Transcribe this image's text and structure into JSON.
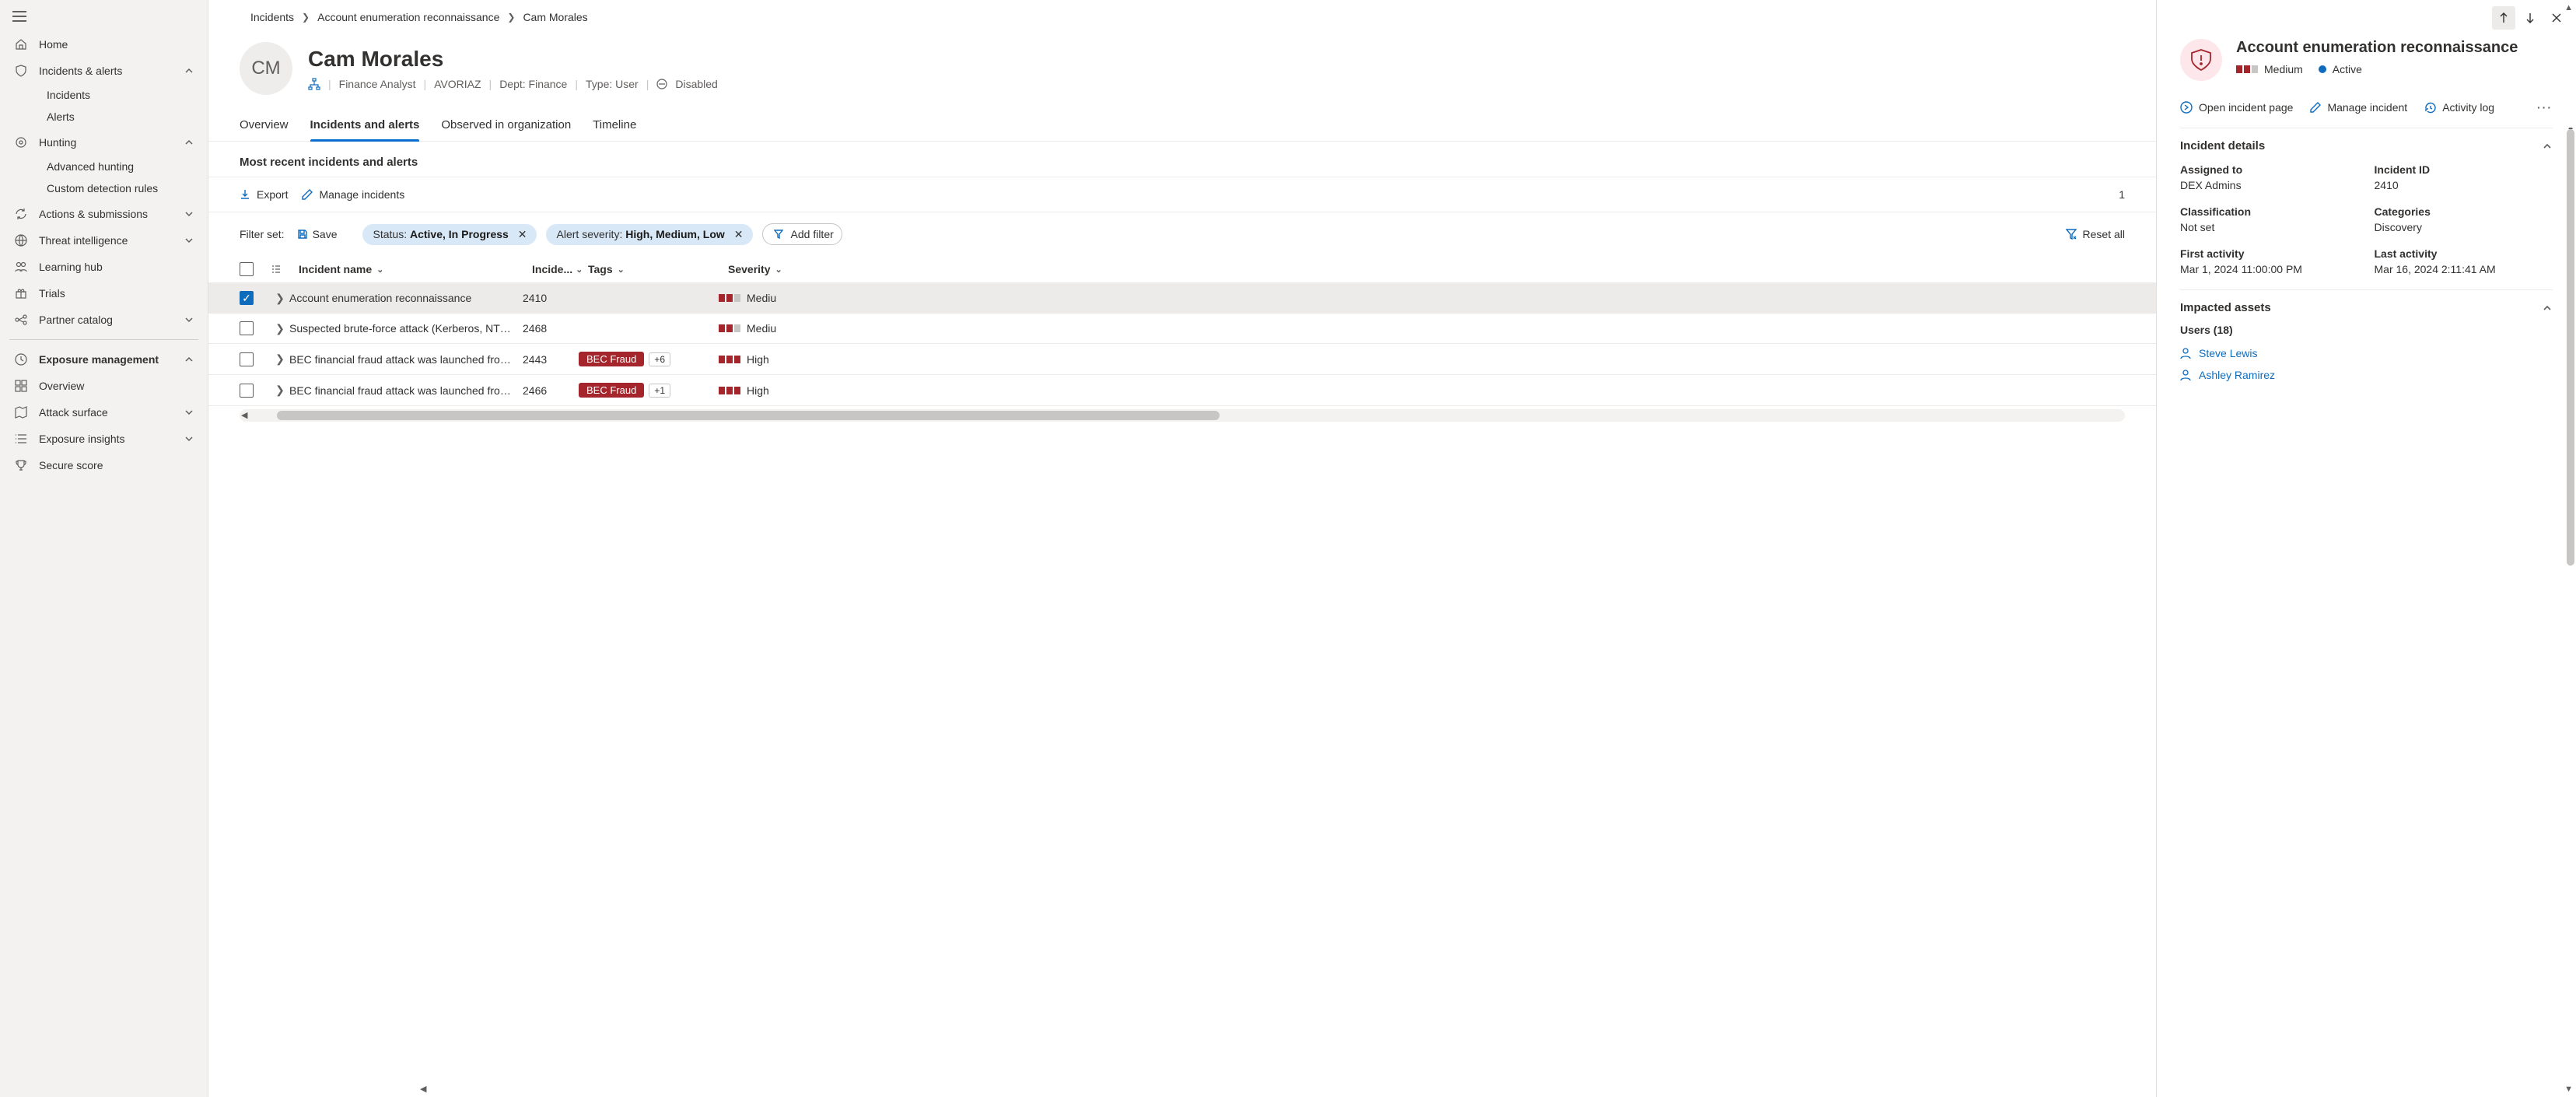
{
  "sidebar": {
    "home": "Home",
    "incidents_alerts": "Incidents & alerts",
    "incidents": "Incidents",
    "alerts": "Alerts",
    "hunting": "Hunting",
    "advanced_hunting": "Advanced hunting",
    "custom_rules": "Custom detection rules",
    "actions": "Actions & submissions",
    "threat_intel": "Threat intelligence",
    "learning": "Learning hub",
    "trials": "Trials",
    "partner": "Partner catalog",
    "exposure": "Exposure management",
    "overview": "Overview",
    "attack_surface": "Attack surface",
    "exposure_insights": "Exposure insights",
    "secure_score": "Secure score"
  },
  "breadcrumb": {
    "a": "Incidents",
    "b": "Account enumeration reconnaissance",
    "c": "Cam Morales"
  },
  "header": {
    "initials": "CM",
    "name": "Cam Morales",
    "role": "Finance Analyst",
    "host": "AVORIAZ",
    "dept": "Dept: Finance",
    "type": "Type: User",
    "disabled": "Disabled"
  },
  "tabs": {
    "overview": "Overview",
    "incidents": "Incidents and alerts",
    "observed": "Observed in organization",
    "timeline": "Timeline"
  },
  "section_title": "Most recent incidents and alerts",
  "toolbar": {
    "export": "Export",
    "manage": "Manage incidents",
    "count": "1"
  },
  "filters": {
    "label": "Filter set:",
    "save": "Save",
    "status_k": "Status: ",
    "status_v": "Active, In Progress",
    "sev_k": "Alert severity: ",
    "sev_v": "High, Medium, Low",
    "add": "Add filter",
    "reset": "Reset all"
  },
  "columns": {
    "name": "Incident name",
    "id": "Incide...",
    "tags": "Tags",
    "sev": "Severity"
  },
  "rows": [
    {
      "name": "Account enumeration reconnaissance",
      "id": "2410",
      "tags": [],
      "more": "",
      "sev": "Mediu",
      "sev_hi": 2,
      "checked": true
    },
    {
      "name": "Suspected brute-force attack (Kerberos, NTLM)",
      "id": "2468",
      "tags": [],
      "more": "",
      "sev": "Mediu",
      "sev_hi": 2,
      "checked": false
    },
    {
      "name": "BEC financial fraud attack was launched from a ...",
      "id": "2443",
      "tags": [
        "BEC Fraud"
      ],
      "more": "+6",
      "sev": "High",
      "sev_hi": 3,
      "checked": false
    },
    {
      "name": "BEC financial fraud attack was launched from a ...",
      "id": "2466",
      "tags": [
        "BEC Fraud"
      ],
      "more": "+1",
      "sev": "High",
      "sev_hi": 3,
      "checked": false
    }
  ],
  "panel": {
    "title": "Account enumeration reconnaissance",
    "sev": "Medium",
    "status": "Active",
    "open": "Open incident page",
    "manage": "Manage incident",
    "log": "Activity log",
    "acc1": "Incident details",
    "assigned_l": "Assigned to",
    "assigned_v": "DEX Admins",
    "incid_l": "Incident ID",
    "incid_v": "2410",
    "class_l": "Classification",
    "class_v": "Not set",
    "cat_l": "Categories",
    "cat_v": "Discovery",
    "first_l": "First activity",
    "first_v": "Mar 1, 2024 11:00:00 PM",
    "last_l": "Last activity",
    "last_v": "Mar 16, 2024 2:11:41 AM",
    "acc2": "Impacted assets",
    "users_h": "Users (18)",
    "user1": "Steve Lewis",
    "user2": "Ashley Ramirez"
  }
}
